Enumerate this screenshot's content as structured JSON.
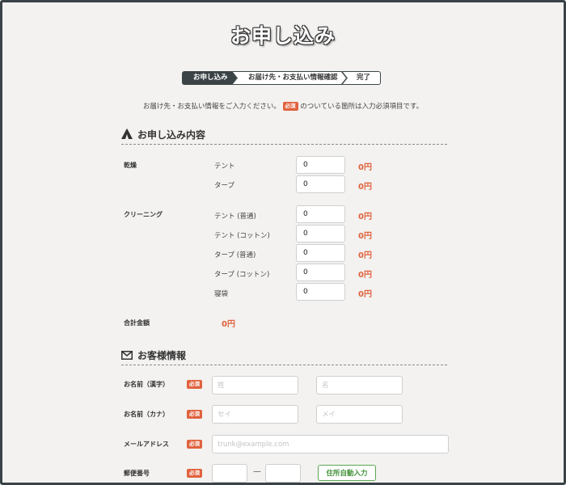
{
  "page": {
    "title": "お申し込み"
  },
  "steps": [
    {
      "label": "お申し込み"
    },
    {
      "label": "お届け先・お支払い情報確認"
    },
    {
      "label": "完了"
    }
  ],
  "intro": {
    "before": "お届け先・お支払い情報をご入力ください。",
    "badge": "必須",
    "after": "のついている箇所は入力必須項目です。"
  },
  "order_section": {
    "heading": "お申し込み内容",
    "icon": "tent-icon",
    "drying": {
      "label": "乾燥",
      "items": [
        {
          "name": "テント",
          "qty": "0",
          "price": "0円"
        },
        {
          "name": "タープ",
          "qty": "0",
          "price": "0円"
        }
      ]
    },
    "cleaning": {
      "label": "クリーニング",
      "items": [
        {
          "name": "テント (普通)",
          "qty": "0",
          "price": "0円"
        },
        {
          "name": "テント (コットン)",
          "qty": "0",
          "price": "0円"
        },
        {
          "name": "タープ (普通)",
          "qty": "0",
          "price": "0円"
        },
        {
          "name": "タープ (コットン)",
          "qty": "0",
          "price": "0円"
        },
        {
          "name": "寝袋",
          "qty": "0",
          "price": "0円"
        }
      ]
    },
    "total_label": "合計金額",
    "total_value": "0円"
  },
  "customer_section": {
    "heading": "お客様情報",
    "icon": "mail-icon",
    "required_badge": "必須",
    "name_kanji": {
      "label": "お名前（漢字）",
      "last_placeholder": "姓",
      "first_placeholder": "名"
    },
    "name_kana": {
      "label": "お名前（カナ）",
      "last_placeholder": "セイ",
      "first_placeholder": "メイ"
    },
    "email": {
      "label": "メールアドレス",
      "placeholder": "trunk@example.com"
    },
    "postal": {
      "label": "郵便番号",
      "separator": "—",
      "button": "住所自動入力"
    }
  },
  "colors": {
    "accent": "#e0623e",
    "dark": "#3b4346",
    "green": "#5aa84f",
    "background": "#f3f2f0"
  }
}
